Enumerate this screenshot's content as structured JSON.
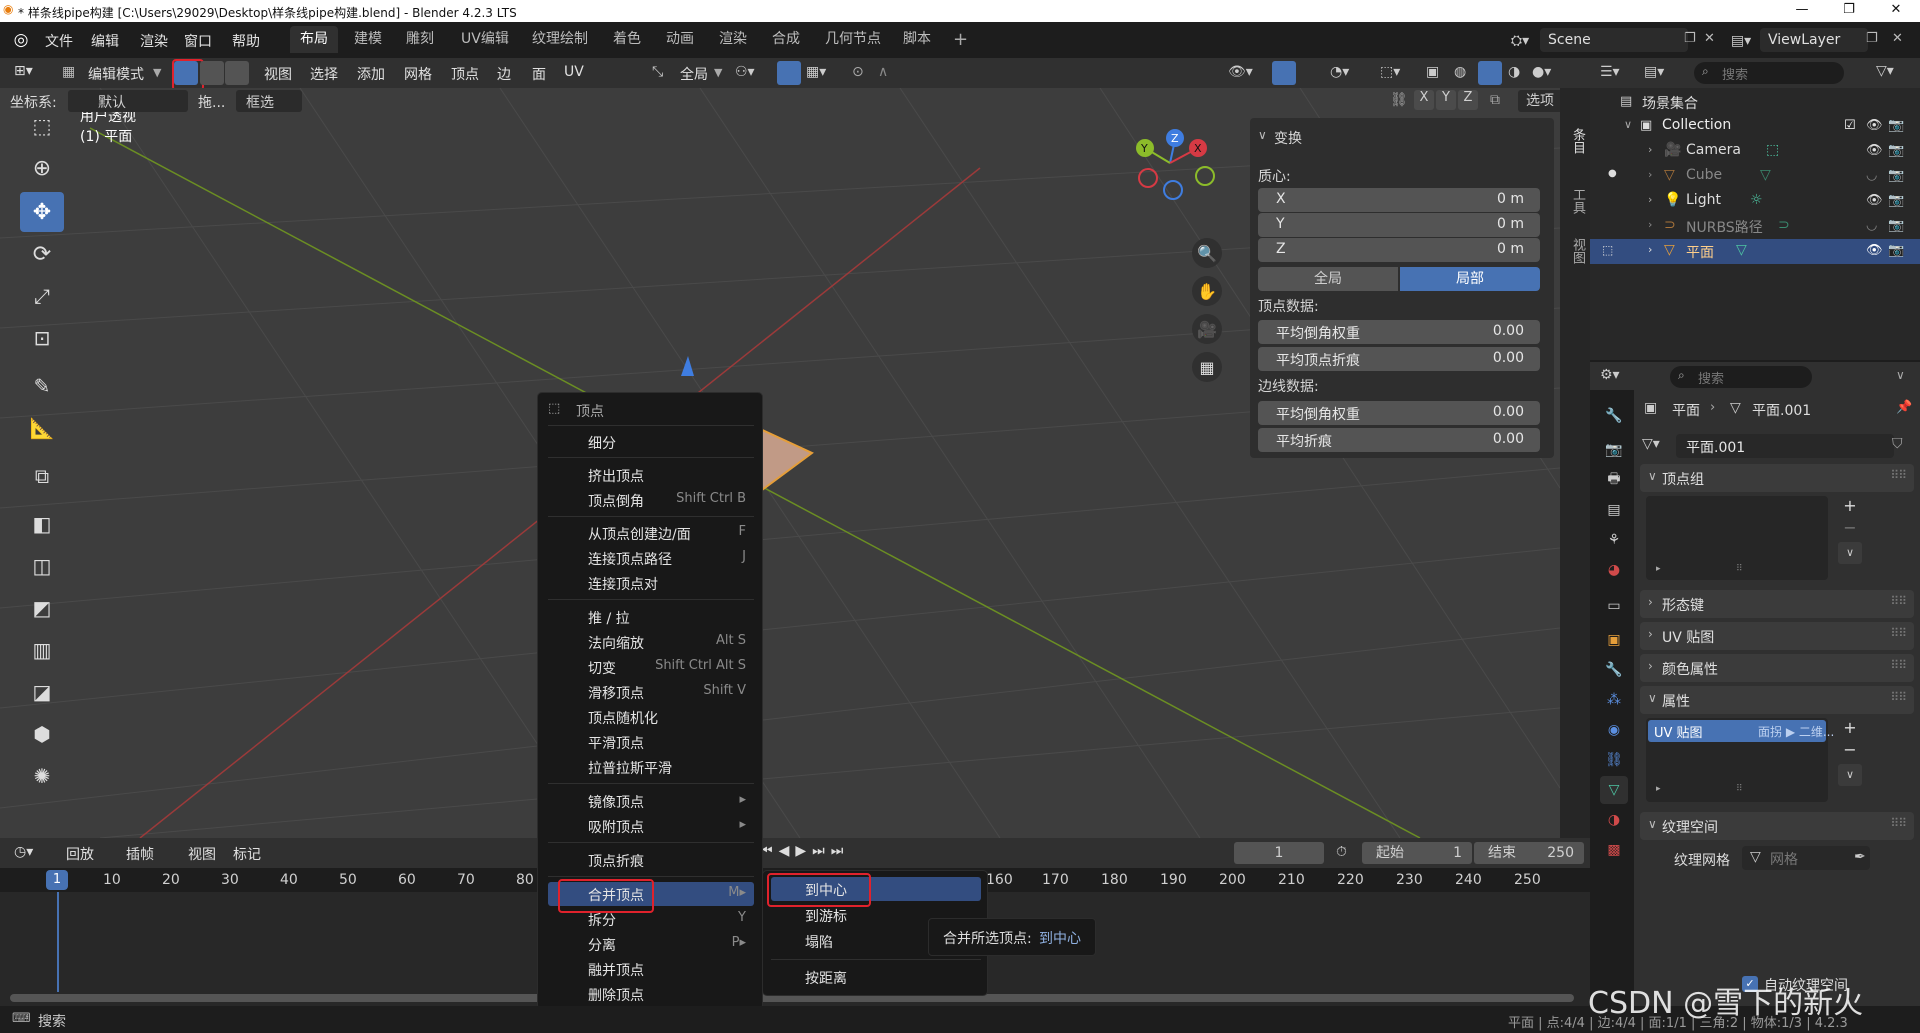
{
  "window": {
    "title": "* 样条线pipe构建 [C:\\Users\\29029\\Desktop\\样条线pipe构建.blend] - Blender 4.2.3 LTS",
    "controls": [
      "—",
      "❐",
      "✕"
    ]
  },
  "menubar": {
    "items": [
      "文件",
      "编辑",
      "渲染",
      "窗口",
      "帮助"
    ],
    "workspaces": [
      "布局",
      "建模",
      "雕刻",
      "UV编辑",
      "纹理绘制",
      "着色",
      "动画",
      "渲染",
      "合成",
      "几何节点",
      "脚本"
    ],
    "active_workspace": "布局",
    "scene": "Scene",
    "view_layer": "ViewLayer"
  },
  "header": {
    "mode": "编辑模式",
    "menus": [
      "视图",
      "选择",
      "添加",
      "网格",
      "顶点",
      "边",
      "面",
      "UV"
    ],
    "transform_orientation": "全局",
    "coord_label": "坐标系:",
    "coord_value": "默认",
    "drag_label": "拖...",
    "select_mode": "框选",
    "mirror_axes": [
      "X",
      "Y",
      "Z"
    ],
    "options_label": "选项"
  },
  "viewport": {
    "view_name": "用户透视",
    "object_name": "(1) 平面"
  },
  "npanel": {
    "section_title": "变换",
    "median_label": "质心:",
    "median": [
      {
        "axis": "X",
        "value": "0 m"
      },
      {
        "axis": "Y",
        "value": "0 m"
      },
      {
        "axis": "Z",
        "value": "0 m"
      }
    ],
    "space_global": "全局",
    "space_local": "局部",
    "vertex_data_label": "顶点数据:",
    "vertex_data": [
      {
        "label": "平均倒角权重",
        "value": "0.00"
      },
      {
        "label": "平均顶点折痕",
        "value": "0.00"
      }
    ],
    "edge_data_label": "边线数据:",
    "edge_data": [
      {
        "label": "平均倒角权重",
        "value": "0.00"
      },
      {
        "label": "平均折痕",
        "value": "0.00"
      }
    ],
    "side_tabs": [
      "条目",
      "工具",
      "视图"
    ]
  },
  "context_menu": {
    "title": "顶点",
    "items": [
      {
        "label": "细分",
        "shortcut": ""
      },
      {
        "label": "挤出顶点",
        "shortcut": ""
      },
      {
        "label": "顶点倒角",
        "shortcut": "Shift Ctrl B"
      },
      {
        "label": "从顶点创建边/面",
        "shortcut": "F"
      },
      {
        "label": "连接顶点路径",
        "shortcut": "J"
      },
      {
        "label": "连接顶点对",
        "shortcut": ""
      },
      {
        "label": "推 / 拉",
        "shortcut": ""
      },
      {
        "label": "法向缩放",
        "shortcut": "Alt S"
      },
      {
        "label": "切变",
        "shortcut": "Shift Ctrl Alt S"
      },
      {
        "label": "滑移顶点",
        "shortcut": "Shift V"
      },
      {
        "label": "顶点随机化",
        "shortcut": ""
      },
      {
        "label": "平滑顶点",
        "shortcut": ""
      },
      {
        "label": "拉普拉斯平滑",
        "shortcut": ""
      },
      {
        "label": "镜像顶点",
        "shortcut": "▸"
      },
      {
        "label": "吸附顶点",
        "shortcut": "▸"
      },
      {
        "label": "顶点折痕",
        "shortcut": ""
      },
      {
        "label": "合并顶点",
        "shortcut": "M▸"
      },
      {
        "label": "拆分",
        "shortcut": "Y"
      },
      {
        "label": "分离",
        "shortcut": "P▸"
      },
      {
        "label": "融并顶点",
        "shortcut": ""
      },
      {
        "label": "删除顶点",
        "shortcut": ""
      }
    ]
  },
  "merge_submenu": {
    "items": [
      "到中心",
      "到游标",
      "塌陷",
      "按距离"
    ],
    "tooltip_label": "合并所选顶点:",
    "tooltip_value": "到中心"
  },
  "timeline": {
    "menus": [
      "回放",
      "插帧",
      "视图",
      "标记"
    ],
    "current_frame": "1",
    "start_label": "起始",
    "start": "1",
    "end_label": "结束",
    "end": "250",
    "ruler": [
      "1",
      "10",
      "20",
      "30",
      "40",
      "50",
      "60",
      "70",
      "80",
      "160",
      "170",
      "180",
      "190",
      "200",
      "210",
      "220",
      "230",
      "240",
      "250"
    ]
  },
  "outliner": {
    "search_placeholder": "搜索",
    "root": "场景集合",
    "collection": "Collection",
    "objects": [
      {
        "name": "Camera",
        "dim": false
      },
      {
        "name": "Cube",
        "dim": true
      },
      {
        "name": "Light",
        "dim": false
      },
      {
        "name": "NURBS路径",
        "dim": true
      },
      {
        "name": "平面",
        "dim": false
      }
    ]
  },
  "properties": {
    "search_placeholder": "搜索",
    "breadcrumb_object": "平面",
    "breadcrumb_mesh": "平面.001",
    "mesh_name": "平面.001",
    "panels": {
      "vertex_groups": "顶点组",
      "shape_keys": "形态键",
      "uv_maps": "UV 贴图",
      "color_attributes": "颜色属性",
      "attributes": "属性",
      "texture_space": "纹理空间"
    },
    "attribute_item": "UV 贴图",
    "attribute_domain": "面拐 ▶ 二维...",
    "texture_mesh_label": "纹理网格",
    "texture_mesh_placeholder": "网格",
    "auto_texspace": "自动纹理空间"
  },
  "statusbar": {
    "search": "搜索",
    "stats": "平面 | 点:4/4 | 边:4/4 | 面:1/1 | 三角:2 | 物体:1/3 | 4.2.3"
  },
  "watermark": "CSDN @雪下的新火"
}
